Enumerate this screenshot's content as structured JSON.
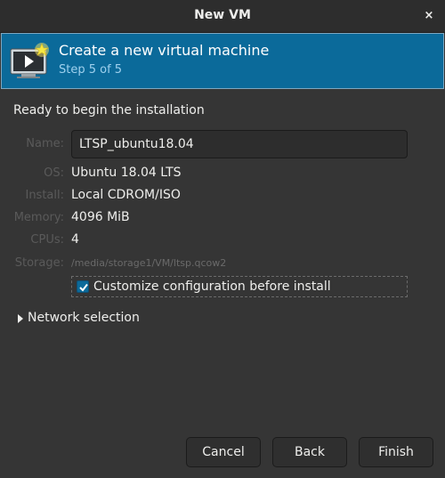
{
  "window": {
    "title": "New VM",
    "close_icon": "×"
  },
  "header": {
    "title": "Create a new virtual machine",
    "step": "Step 5 of 5",
    "icon": "vm-monitor-icon",
    "colors": {
      "background": "#0b6a9a",
      "step_text": "#9fd1ee"
    }
  },
  "summary": {
    "heading": "Ready to begin the installation",
    "name_label": "Name:",
    "name_value": "LTSP_ubuntu18.04",
    "os_label": "OS:",
    "os_value": "Ubuntu 18.04 LTS",
    "install_label": "Install:",
    "install_value": "Local CDROM/ISO",
    "memory_label": "Memory:",
    "memory_value": "4096 MiB",
    "cpus_label": "CPUs:",
    "cpus_value": "4",
    "storage_label": "Storage:",
    "storage_value": "/media/storage1/VM/ltsp.qcow2"
  },
  "customize": {
    "label": "Customize configuration before install",
    "checked": true
  },
  "network": {
    "label": "Network selection",
    "expanded": false
  },
  "buttons": {
    "cancel": "Cancel",
    "back": "Back",
    "finish": "Finish"
  }
}
